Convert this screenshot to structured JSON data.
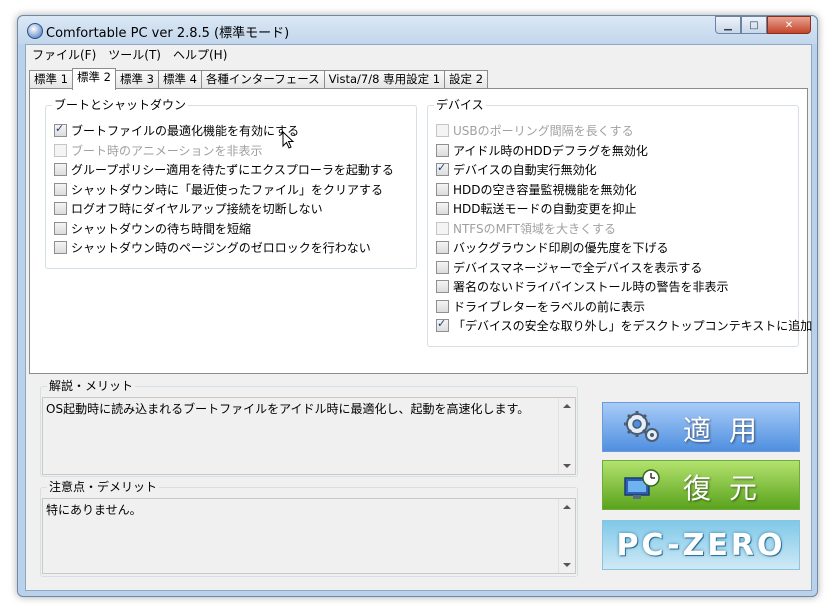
{
  "window": {
    "title": "Comfortable PC ver 2.8.5 (標準モード)"
  },
  "menu": [
    "ファイル(F)",
    "ツール(T)",
    "ヘルプ(H)"
  ],
  "tabs": [
    "標準 1",
    "標準 2",
    "標準 3",
    "標準 4",
    "各種インターフェース",
    "Vista/7/8 専用設定 1",
    "設定 2"
  ],
  "active_tab": "標準 2",
  "boot_group": {
    "title": "ブートとシャットダウン",
    "items": [
      {
        "label": "ブートファイルの最適化機能を有効にする",
        "checked": true,
        "disabled": false
      },
      {
        "label": "ブート時のアニメーションを非表示",
        "checked": false,
        "disabled": true
      },
      {
        "label": "グループポリシー適用を待たずにエクスプローラを起動する",
        "checked": false,
        "disabled": false
      },
      {
        "label": "シャットダウン時に「最近使ったファイル」をクリアする",
        "checked": false,
        "disabled": false
      },
      {
        "label": "ログオフ時にダイヤルアップ接続を切断しない",
        "checked": false,
        "disabled": false
      },
      {
        "label": "シャットダウンの待ち時間を短縮",
        "checked": false,
        "disabled": false
      },
      {
        "label": "シャットダウン時のページングのゼロロックを行わない",
        "checked": false,
        "disabled": false
      }
    ]
  },
  "device_group": {
    "title": "デバイス",
    "items": [
      {
        "label": "USBのポーリング間隔を長くする",
        "checked": false,
        "disabled": true
      },
      {
        "label": "アイドル時のHDDデフラグを無効化",
        "checked": false,
        "disabled": false
      },
      {
        "label": "デバイスの自動実行無効化",
        "checked": true,
        "disabled": false
      },
      {
        "label": "HDDの空き容量監視機能を無効化",
        "checked": false,
        "disabled": false
      },
      {
        "label": "HDD転送モードの自動変更を抑止",
        "checked": false,
        "disabled": false
      },
      {
        "label": "NTFSのMFT領域を大きくする",
        "checked": false,
        "disabled": true
      },
      {
        "label": "バックグラウンド印刷の優先度を下げる",
        "checked": false,
        "disabled": false
      },
      {
        "label": "デバイスマネージャーで全デバイスを表示する",
        "checked": false,
        "disabled": false
      },
      {
        "label": "署名のないドライバインストール時の警告を非表示",
        "checked": false,
        "disabled": false
      },
      {
        "label": "ドライブレターをラベルの前に表示",
        "checked": false,
        "disabled": false
      },
      {
        "label": "「デバイスの安全な取り外し」をデスクトップコンテキストに追加",
        "checked": true,
        "disabled": false
      }
    ]
  },
  "description": {
    "title": "解説・メリット",
    "text": "OS起動時に読み込まれるブートファイルをアイドル時に最適化し、起動を高速化します。"
  },
  "caution": {
    "title": "注意点・デメリット",
    "text": "特にありません。"
  },
  "buttons": {
    "apply": "適用",
    "restore": "復元",
    "logo": "PC-ZERO"
  },
  "icons": {
    "apply": "gears-icon",
    "restore": "pc-clock-icon",
    "app": "app-icon"
  },
  "colors": {
    "apply": "#4f8fe0",
    "restore": "#5aa31d",
    "logo": "#7fc9e8"
  }
}
